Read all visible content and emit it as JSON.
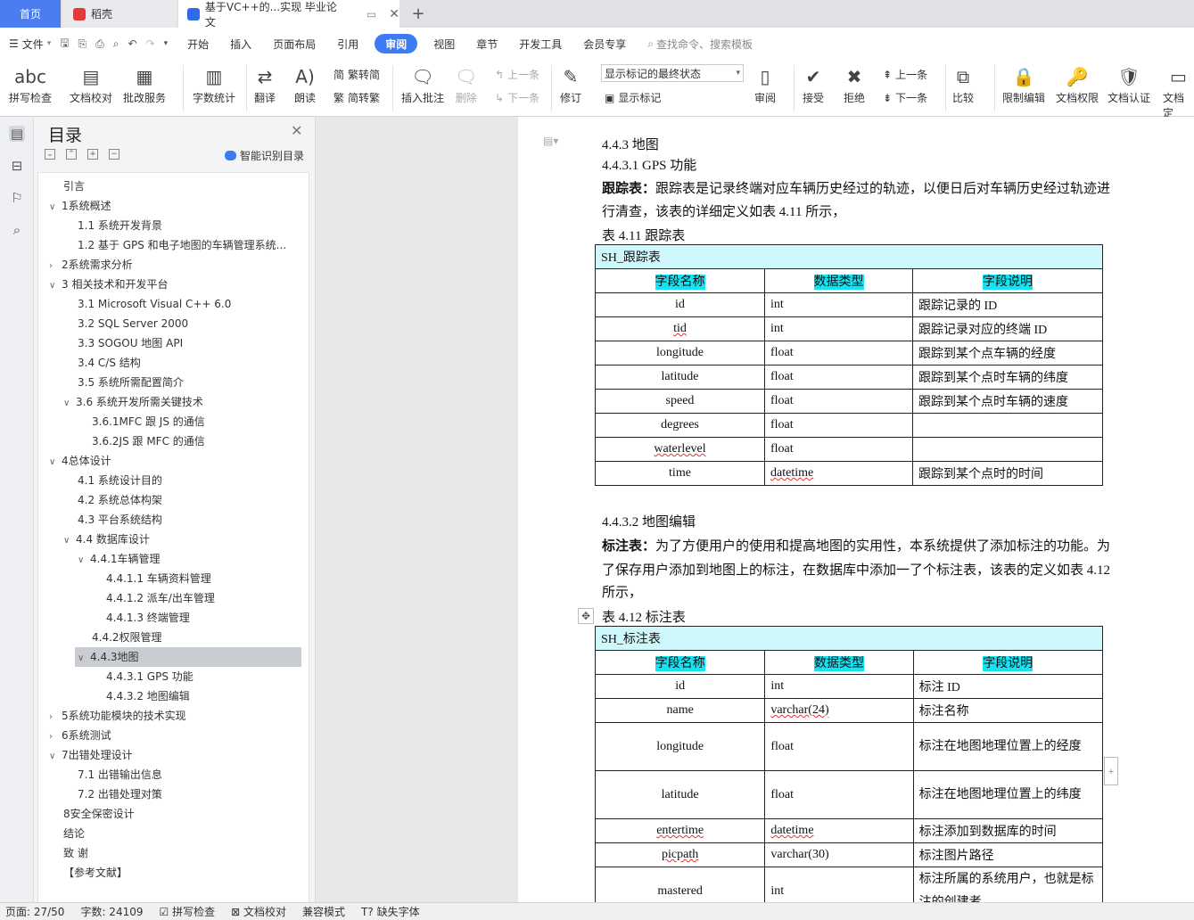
{
  "tabs": {
    "home": "首页",
    "daoke": "稻壳",
    "doc": "基于VC++的...实现 毕业论文"
  },
  "menu": {
    "file": "文件",
    "items": [
      "开始",
      "插入",
      "页面布局",
      "引用",
      "审阅",
      "视图",
      "章节",
      "开发工具",
      "会员专享"
    ],
    "search": "查找命令、搜索模板"
  },
  "ribbon": {
    "spell": "拼写检查",
    "doccheck": "文档校对",
    "batch": "批改服务",
    "wordcount": "字数统计",
    "translate": "翻译",
    "read": "朗读",
    "t2s": "繁转简",
    "s2t": "简转繁",
    "insertcomment": "插入批注",
    "delete": "删除",
    "prev": "上一条",
    "next": "下一条",
    "revise": "修订",
    "markmode": "显示标记的最终状态",
    "showmark": "显示标记",
    "review": "审阅",
    "accept": "接受",
    "reject": "拒绝",
    "prev2": "上一条",
    "next2": "下一条",
    "compare": "比较",
    "restrict": "限制编辑",
    "docperm": "文档权限",
    "docauth": "文档认证",
    "docfinal": "文档定"
  },
  "toc": {
    "title": "目录",
    "ai": "智能识别目录",
    "items": [
      "引言",
      "1系统概述",
      "1.1  系统开发背景",
      "1.2  基于 GPS 和电子地图的车辆管理系统...",
      "2系统需求分析",
      "3  相关技术和开发平台",
      "3.1  Microsoft Visual C++ 6.0",
      "3.2  SQL Server 2000",
      "3.3  SOGOU 地图 API",
      "3.4  C/S  结构",
      "3.5  系统所需配置简介",
      "3.6  系统开发所需关键技术",
      "3.6.1MFC  跟 JS  的通信",
      "3.6.2JS  跟 MFC  的通信",
      "4总体设计",
      "4.1  系统设计目的",
      "4.2  系统总体构架",
      "4.3  平台系统结构",
      "4.4  数据库设计",
      "4.4.1车辆管理",
      "4.4.1.1  车辆资料管理",
      "4.4.1.2  派车/出车管理",
      "4.4.1.3  终端管理",
      "4.4.2权限管理",
      "4.4.3地图",
      "4.4.3.1 GPS  功能",
      "4.4.3.2  地图编辑",
      "5系统功能模块的技术实现",
      "6系统测试",
      "7出错处理设计",
      "7.1  出错输出信息",
      "7.2  出错处理对策",
      "8安全保密设计",
      "结论",
      "致    谢",
      "【参考文献】"
    ]
  },
  "doc": {
    "h443": "4.4.3    地图",
    "h4431": "4.4.3.1 GPS  功能",
    "p1a_b": "跟踪表：",
    "p1a": "跟踪表是记录终端对应车辆历史经过的轨迹，以便日后对车辆历史经过轨迹进",
    "p1b": "行清查，该表的详细定义如表 4.11 所示，",
    "cap1": "表  4.11  跟踪表",
    "t1name": "SH_跟踪表",
    "hdr": [
      "字段名称",
      "数据类型",
      "字段说明"
    ],
    "t1rows": [
      [
        "id",
        "int",
        "跟踪记录的  ID"
      ],
      [
        "tid",
        "int",
        "跟踪记录对应的终端 ID"
      ],
      [
        "longitude",
        "float",
        "跟踪到某个点车辆的经度"
      ],
      [
        "latitude",
        "float",
        "跟踪到某个点时车辆的纬度"
      ],
      [
        "speed",
        "float",
        "跟踪到某个点时车辆的速度"
      ],
      [
        "degrees",
        "float",
        ""
      ],
      [
        "waterlevel",
        "float",
        ""
      ],
      [
        "time",
        "datetime",
        "跟踪到某个点时的时间"
      ]
    ],
    "h4432": "4.4.3.2  地图编辑",
    "p2a_b": "标注表：",
    "p2a": "为了方便用户的使用和提高地图的实用性，本系统提供了添加标注的功能。为",
    "p2b": "了保存用户添加到地图上的标注，在数据库中添加一了个标注表，该表的定义如表 4.12",
    "p2c": "所示，",
    "cap2": "表 4.12  标注表",
    "t2name": "SH_标注表",
    "t2rows": [
      [
        "id",
        "int",
        "标注 ID"
      ],
      [
        "name",
        "varchar(24)",
        "标注名称"
      ],
      [
        "longitude",
        "float",
        "标注在地图地理位置上的经度"
      ],
      [
        "latitude",
        "float",
        "标注在地图地理位置上的纬度"
      ],
      [
        "entertime",
        "datetime",
        "标注添加到数据库的时间"
      ],
      [
        "picpath",
        "varchar(30)",
        "标注图片路径"
      ],
      [
        "mastered",
        "int",
        "标注所属的系统用户，也就是标注的创建者"
      ]
    ]
  },
  "status": {
    "page": "页面: 27/50",
    "words": "字数: 24109",
    "spell": "拼写检查",
    "check": "文档校对",
    "compat": "兼容模式",
    "font": "缺失字体"
  }
}
